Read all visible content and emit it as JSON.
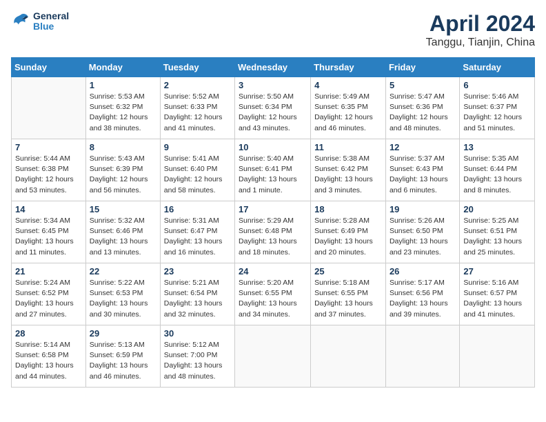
{
  "header": {
    "logo_general": "General",
    "logo_blue": "Blue",
    "title": "April 2024",
    "subtitle": "Tanggu, Tianjin, China"
  },
  "weekdays": [
    "Sunday",
    "Monday",
    "Tuesday",
    "Wednesday",
    "Thursday",
    "Friday",
    "Saturday"
  ],
  "weeks": [
    [
      {
        "day": "",
        "info": ""
      },
      {
        "day": "1",
        "info": "Sunrise: 5:53 AM\nSunset: 6:32 PM\nDaylight: 12 hours\nand 38 minutes."
      },
      {
        "day": "2",
        "info": "Sunrise: 5:52 AM\nSunset: 6:33 PM\nDaylight: 12 hours\nand 41 minutes."
      },
      {
        "day": "3",
        "info": "Sunrise: 5:50 AM\nSunset: 6:34 PM\nDaylight: 12 hours\nand 43 minutes."
      },
      {
        "day": "4",
        "info": "Sunrise: 5:49 AM\nSunset: 6:35 PM\nDaylight: 12 hours\nand 46 minutes."
      },
      {
        "day": "5",
        "info": "Sunrise: 5:47 AM\nSunset: 6:36 PM\nDaylight: 12 hours\nand 48 minutes."
      },
      {
        "day": "6",
        "info": "Sunrise: 5:46 AM\nSunset: 6:37 PM\nDaylight: 12 hours\nand 51 minutes."
      }
    ],
    [
      {
        "day": "7",
        "info": "Sunrise: 5:44 AM\nSunset: 6:38 PM\nDaylight: 12 hours\nand 53 minutes."
      },
      {
        "day": "8",
        "info": "Sunrise: 5:43 AM\nSunset: 6:39 PM\nDaylight: 12 hours\nand 56 minutes."
      },
      {
        "day": "9",
        "info": "Sunrise: 5:41 AM\nSunset: 6:40 PM\nDaylight: 12 hours\nand 58 minutes."
      },
      {
        "day": "10",
        "info": "Sunrise: 5:40 AM\nSunset: 6:41 PM\nDaylight: 13 hours\nand 1 minute."
      },
      {
        "day": "11",
        "info": "Sunrise: 5:38 AM\nSunset: 6:42 PM\nDaylight: 13 hours\nand 3 minutes."
      },
      {
        "day": "12",
        "info": "Sunrise: 5:37 AM\nSunset: 6:43 PM\nDaylight: 13 hours\nand 6 minutes."
      },
      {
        "day": "13",
        "info": "Sunrise: 5:35 AM\nSunset: 6:44 PM\nDaylight: 13 hours\nand 8 minutes."
      }
    ],
    [
      {
        "day": "14",
        "info": "Sunrise: 5:34 AM\nSunset: 6:45 PM\nDaylight: 13 hours\nand 11 minutes."
      },
      {
        "day": "15",
        "info": "Sunrise: 5:32 AM\nSunset: 6:46 PM\nDaylight: 13 hours\nand 13 minutes."
      },
      {
        "day": "16",
        "info": "Sunrise: 5:31 AM\nSunset: 6:47 PM\nDaylight: 13 hours\nand 16 minutes."
      },
      {
        "day": "17",
        "info": "Sunrise: 5:29 AM\nSunset: 6:48 PM\nDaylight: 13 hours\nand 18 minutes."
      },
      {
        "day": "18",
        "info": "Sunrise: 5:28 AM\nSunset: 6:49 PM\nDaylight: 13 hours\nand 20 minutes."
      },
      {
        "day": "19",
        "info": "Sunrise: 5:26 AM\nSunset: 6:50 PM\nDaylight: 13 hours\nand 23 minutes."
      },
      {
        "day": "20",
        "info": "Sunrise: 5:25 AM\nSunset: 6:51 PM\nDaylight: 13 hours\nand 25 minutes."
      }
    ],
    [
      {
        "day": "21",
        "info": "Sunrise: 5:24 AM\nSunset: 6:52 PM\nDaylight: 13 hours\nand 27 minutes."
      },
      {
        "day": "22",
        "info": "Sunrise: 5:22 AM\nSunset: 6:53 PM\nDaylight: 13 hours\nand 30 minutes."
      },
      {
        "day": "23",
        "info": "Sunrise: 5:21 AM\nSunset: 6:54 PM\nDaylight: 13 hours\nand 32 minutes."
      },
      {
        "day": "24",
        "info": "Sunrise: 5:20 AM\nSunset: 6:55 PM\nDaylight: 13 hours\nand 34 minutes."
      },
      {
        "day": "25",
        "info": "Sunrise: 5:18 AM\nSunset: 6:55 PM\nDaylight: 13 hours\nand 37 minutes."
      },
      {
        "day": "26",
        "info": "Sunrise: 5:17 AM\nSunset: 6:56 PM\nDaylight: 13 hours\nand 39 minutes."
      },
      {
        "day": "27",
        "info": "Sunrise: 5:16 AM\nSunset: 6:57 PM\nDaylight: 13 hours\nand 41 minutes."
      }
    ],
    [
      {
        "day": "28",
        "info": "Sunrise: 5:14 AM\nSunset: 6:58 PM\nDaylight: 13 hours\nand 44 minutes."
      },
      {
        "day": "29",
        "info": "Sunrise: 5:13 AM\nSunset: 6:59 PM\nDaylight: 13 hours\nand 46 minutes."
      },
      {
        "day": "30",
        "info": "Sunrise: 5:12 AM\nSunset: 7:00 PM\nDaylight: 13 hours\nand 48 minutes."
      },
      {
        "day": "",
        "info": ""
      },
      {
        "day": "",
        "info": ""
      },
      {
        "day": "",
        "info": ""
      },
      {
        "day": "",
        "info": ""
      }
    ]
  ]
}
